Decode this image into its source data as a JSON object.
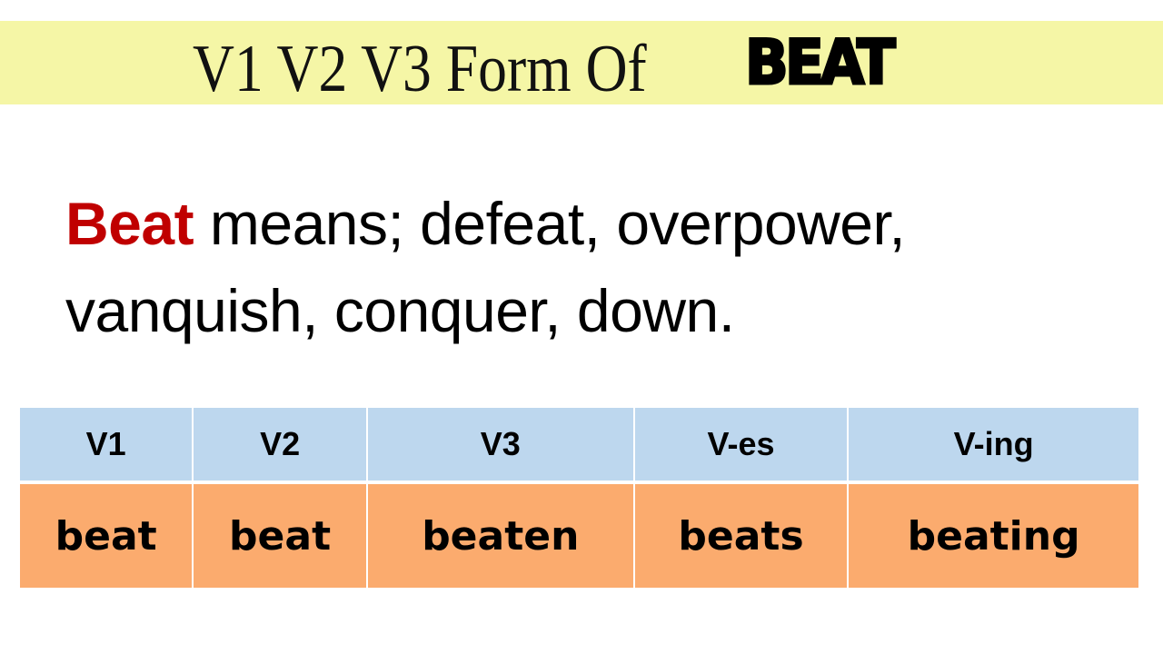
{
  "title": {
    "prefix": "V1 V2 V3 Form Of",
    "word": "BEAT"
  },
  "definition": {
    "keyword": "Beat",
    "text_line1": " means; defeat, overpower,",
    "text_line2": "vanquish, conquer, down."
  },
  "colors": {
    "title_band": "#f5f6a6",
    "keyword": "#c00000",
    "header_row": "#bdd7ee",
    "value_row": "#fbab6e"
  },
  "table": {
    "headers": [
      "V1",
      "V2",
      "V3",
      "V-es",
      "V-ing"
    ],
    "values": [
      "beat",
      "beat",
      "beaten",
      "beats",
      "beating"
    ]
  }
}
